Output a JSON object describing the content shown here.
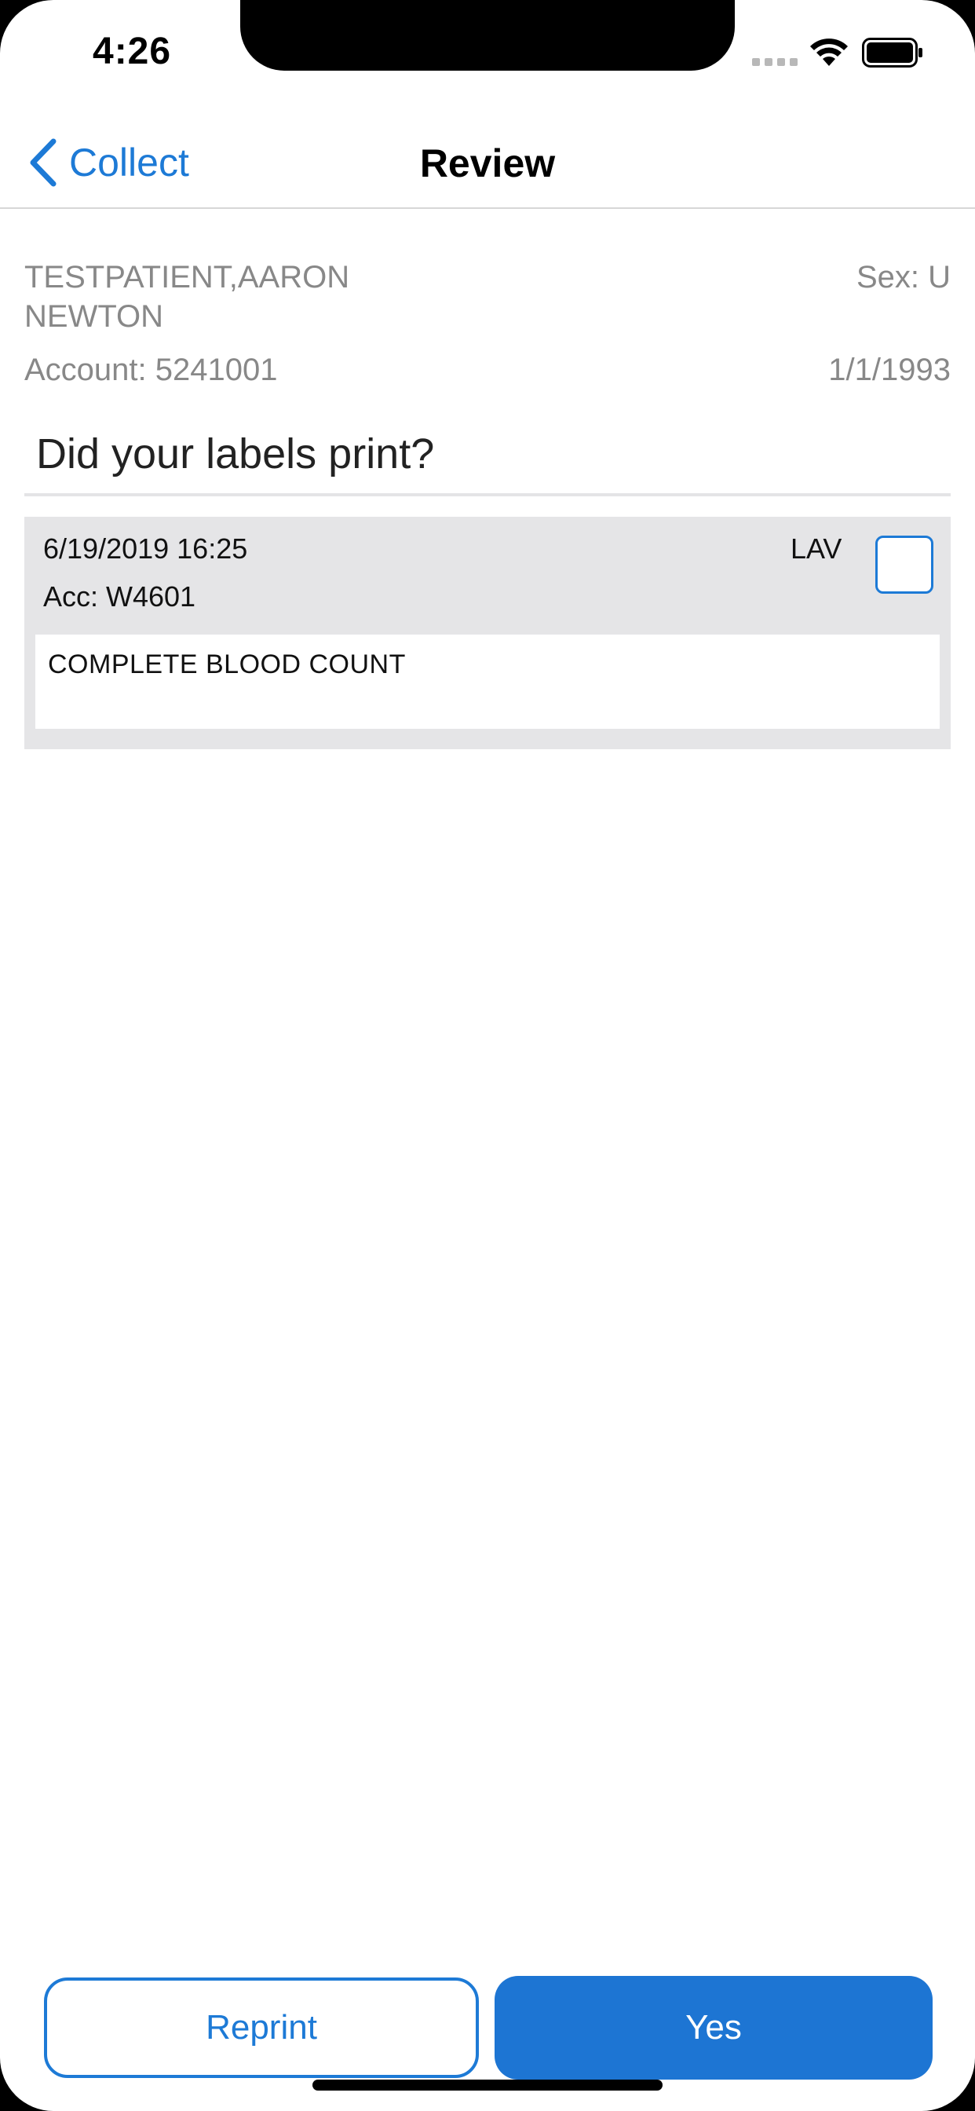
{
  "status_bar": {
    "time": "4:26"
  },
  "nav": {
    "back_label": "Collect",
    "title": "Review"
  },
  "patient": {
    "name": "TESTPATIENT,AARON NEWTON",
    "sex": "Sex: U",
    "account": "Account: 5241001",
    "dob": "1/1/1993"
  },
  "question": "Did your labels print?",
  "orders": [
    {
      "datetime": "6/19/2019 16:25",
      "accession": "Acc: W4601",
      "tube": "LAV",
      "checked": false,
      "test_name": "COMPLETE BLOOD COUNT"
    }
  ],
  "buttons": {
    "reprint_label": "Reprint",
    "yes_label": "Yes"
  },
  "colors": {
    "accent": "#1d7ad6",
    "card_background": "#e5e5e7",
    "secondary_text": "#888888"
  }
}
